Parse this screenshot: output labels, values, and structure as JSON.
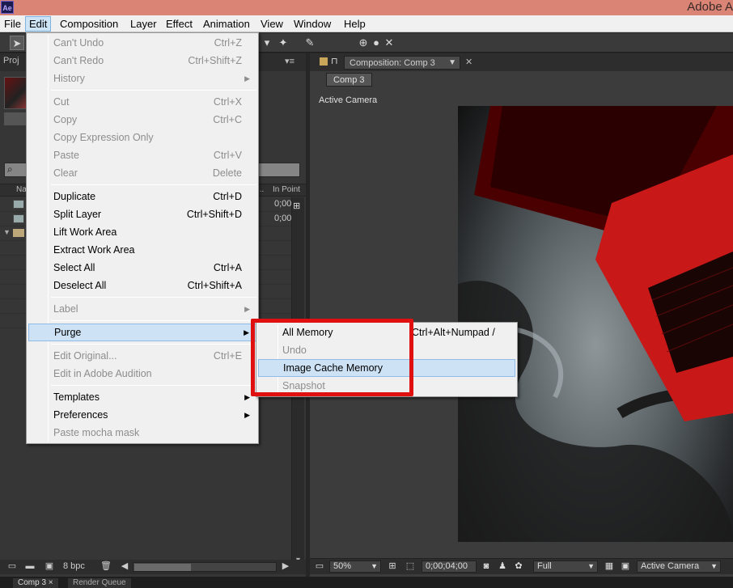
{
  "titlebar": {
    "logo": "Ae",
    "app_title": "Adobe A"
  },
  "menubar": {
    "items": [
      "File",
      "Edit",
      "Composition",
      "Layer",
      "Effect",
      "Animation",
      "View",
      "Window",
      "Help"
    ]
  },
  "toolbar": {
    "icons": [
      "selection-tool",
      "puppet-pin",
      "puppet-overlap",
      "pin",
      "snap",
      "circle",
      "feather"
    ]
  },
  "project": {
    "tab_label": "Proj",
    "col_name": "Na",
    "col_dots": "...",
    "col_in_point": "In Point",
    "rows": [
      {
        "type": "comp",
        "in_point": "0;00"
      },
      {
        "type": "comp",
        "in_point": "0;00"
      },
      {
        "type": "folder",
        "in_point": ""
      }
    ],
    "footer_bpc": "8 bpc"
  },
  "comp": {
    "tab_label": "Composition: Comp 3",
    "breadcrumb": "Comp 3",
    "view_label": "Active Camera",
    "footer": {
      "zoom": "50%",
      "timecode": "0;00;04;00",
      "resolution": "Full",
      "camera": "Active Camera"
    }
  },
  "bottom_tabs": [
    "Comp 3",
    "Render Queue"
  ],
  "edit_menu": {
    "items": [
      {
        "label": "Can't Undo",
        "shortcut": "Ctrl+Z",
        "disabled": true
      },
      {
        "label": "Can't Redo",
        "shortcut": "Ctrl+Shift+Z",
        "disabled": true
      },
      {
        "label": "History",
        "shortcut": "",
        "disabled": true,
        "submenu": true
      },
      {
        "label": "Cut",
        "shortcut": "Ctrl+X",
        "disabled": true
      },
      {
        "label": "Copy",
        "shortcut": "Ctrl+C",
        "disabled": true
      },
      {
        "label": "Copy Expression Only",
        "shortcut": "",
        "disabled": true
      },
      {
        "label": "Paste",
        "shortcut": "Ctrl+V",
        "disabled": true
      },
      {
        "label": "Clear",
        "shortcut": "Delete",
        "disabled": true
      },
      {
        "label": "Duplicate",
        "shortcut": "Ctrl+D",
        "disabled": false
      },
      {
        "label": "Split Layer",
        "shortcut": "Ctrl+Shift+D",
        "disabled": false
      },
      {
        "label": "Lift Work Area",
        "shortcut": "",
        "disabled": false
      },
      {
        "label": "Extract Work Area",
        "shortcut": "",
        "disabled": false
      },
      {
        "label": "Select All",
        "shortcut": "Ctrl+A",
        "disabled": false
      },
      {
        "label": "Deselect All",
        "shortcut": "Ctrl+Shift+A",
        "disabled": false
      },
      {
        "label": "Label",
        "shortcut": "",
        "disabled": true,
        "submenu": true
      },
      {
        "label": "Purge",
        "shortcut": "",
        "disabled": false,
        "submenu": true,
        "highlighted": true
      },
      {
        "label": "Edit Original...",
        "shortcut": "Ctrl+E",
        "disabled": true
      },
      {
        "label": "Edit in Adobe Audition",
        "shortcut": "",
        "disabled": true
      },
      {
        "label": "Templates",
        "shortcut": "",
        "disabled": false,
        "submenu": true
      },
      {
        "label": "Preferences",
        "shortcut": "",
        "disabled": false,
        "submenu": true
      },
      {
        "label": "Paste mocha mask",
        "shortcut": "",
        "disabled": true
      }
    ]
  },
  "purge_menu": {
    "items": [
      {
        "label": "All Memory",
        "shortcut": "Ctrl+Alt+Numpad /",
        "disabled": false
      },
      {
        "label": "Undo",
        "shortcut": "",
        "disabled": true
      },
      {
        "label": "Image Cache Memory",
        "shortcut": "",
        "disabled": false,
        "highlighted": true
      },
      {
        "label": "Snapshot",
        "shortcut": "",
        "disabled": true
      }
    ]
  },
  "colors": {
    "highlight_outline": "#e01010",
    "menu_highlight": "#cde2f5"
  }
}
